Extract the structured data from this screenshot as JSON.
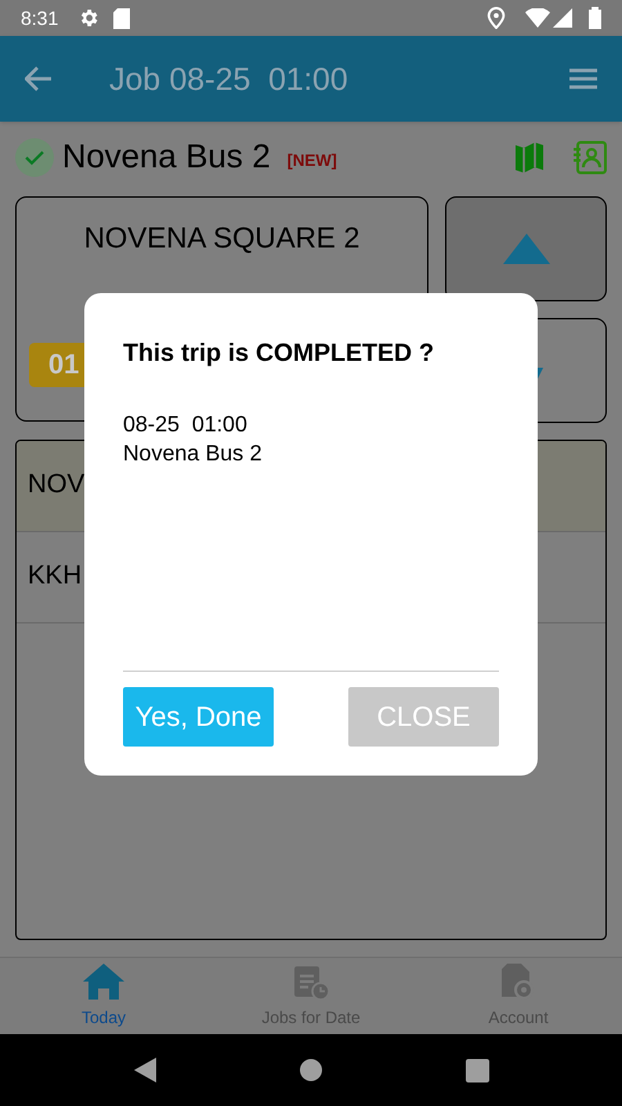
{
  "status_bar": {
    "time": "8:31"
  },
  "app_bar": {
    "title": "Job 08-25  01:00"
  },
  "job": {
    "name": "Novena Bus 2",
    "badge": "[NEW]",
    "completed": true
  },
  "stop_card": {
    "title": "NOVENA SQUARE 2",
    "badge": "01"
  },
  "stops": [
    {
      "label": "NOV",
      "selected": true
    },
    {
      "label": "KKH",
      "selected": false
    }
  ],
  "dialog": {
    "title": "This trip is COMPLETED ?",
    "lines": [
      "08-25  01:00",
      "Novena Bus 2"
    ],
    "buttons": [
      {
        "label": "Yes, Done",
        "kind": "primary"
      },
      {
        "label": "CLOSE",
        "kind": "secondary"
      }
    ]
  },
  "bottom_nav": [
    {
      "label": "Today",
      "kind": "home",
      "selected": true
    },
    {
      "label": "Jobs for Date",
      "kind": "clipboard",
      "selected": false
    },
    {
      "label": "Account",
      "kind": "file-gear",
      "selected": false
    }
  ]
}
